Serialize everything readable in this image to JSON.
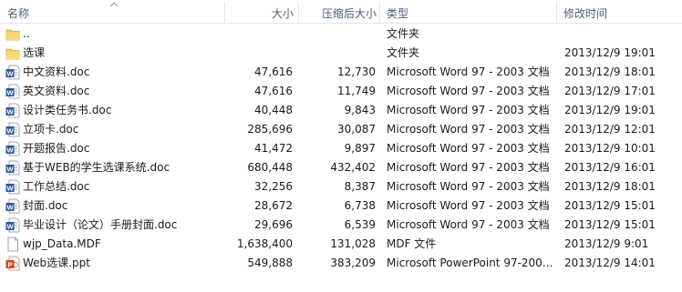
{
  "columns": {
    "name": "名称",
    "size": "大小",
    "compressed": "压缩后大小",
    "type": "类型",
    "modified": "修改时间"
  },
  "rows": [
    {
      "icon": "folder-icon",
      "name": "..",
      "size": "",
      "compressed": "",
      "type": "文件夹",
      "modified": ""
    },
    {
      "icon": "folder-icon",
      "name": "选课",
      "size": "",
      "compressed": "",
      "type": "文件夹",
      "modified": "2013/12/9 19:01"
    },
    {
      "icon": "word-doc-icon",
      "name": "中文资料.doc",
      "size": "47,616",
      "compressed": "12,730",
      "type": "Microsoft Word 97 - 2003 文档",
      "modified": "2013/12/9 18:01"
    },
    {
      "icon": "word-doc-icon",
      "name": "英文资料.doc",
      "size": "47,616",
      "compressed": "11,749",
      "type": "Microsoft Word 97 - 2003 文档",
      "modified": "2013/12/9 17:01"
    },
    {
      "icon": "word-doc-icon",
      "name": "设计类任务书.doc",
      "size": "40,448",
      "compressed": "9,843",
      "type": "Microsoft Word 97 - 2003 文档",
      "modified": "2013/12/9 19:01"
    },
    {
      "icon": "word-doc-icon",
      "name": "立项卡.doc",
      "size": "285,696",
      "compressed": "30,087",
      "type": "Microsoft Word 97 - 2003 文档",
      "modified": "2013/12/9 12:01"
    },
    {
      "icon": "word-doc-icon",
      "name": "开题报告.doc",
      "size": "41,472",
      "compressed": "9,897",
      "type": "Microsoft Word 97 - 2003 文档",
      "modified": "2013/12/9 10:01"
    },
    {
      "icon": "word-doc-icon",
      "name": "基于WEB的学生选课系统.doc",
      "size": "680,448",
      "compressed": "432,402",
      "type": "Microsoft Word 97 - 2003 文档",
      "modified": "2013/12/9 16:01"
    },
    {
      "icon": "word-doc-icon",
      "name": "工作总结.doc",
      "size": "32,256",
      "compressed": "8,387",
      "type": "Microsoft Word 97 - 2003 文档",
      "modified": "2013/12/9 18:01"
    },
    {
      "icon": "word-doc-icon",
      "name": "封面.doc",
      "size": "28,672",
      "compressed": "6,738",
      "type": "Microsoft Word 97 - 2003 文档",
      "modified": "2013/12/9 15:01"
    },
    {
      "icon": "word-doc-icon",
      "name": "毕业设计（论文）手册封面.doc",
      "size": "29,696",
      "compressed": "6,539",
      "type": "Microsoft Word 97 - 2003 文档",
      "modified": "2013/12/9 15:01"
    },
    {
      "icon": "blank-file-icon",
      "name": "wjp_Data.MDF",
      "size": "1,638,400",
      "compressed": "131,028",
      "type": "MDF 文件",
      "modified": "2013/12/9 9:01"
    },
    {
      "icon": "powerpoint-icon",
      "name": "Web选课.ppt",
      "size": "549,888",
      "compressed": "383,209",
      "type": "Microsoft PowerPoint 97-200...",
      "modified": "2013/12/9 14:01"
    }
  ]
}
